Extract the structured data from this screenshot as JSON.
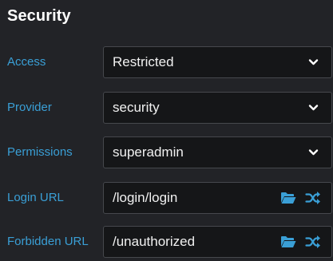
{
  "section": {
    "title": "Security"
  },
  "fields": {
    "access": {
      "label": "Access",
      "value": "Restricted"
    },
    "provider": {
      "label": "Provider",
      "value": "security"
    },
    "permissions": {
      "label": "Permissions",
      "value": "superadmin"
    },
    "login_url": {
      "label": "Login URL",
      "value": "/login/login"
    },
    "forbidden_url": {
      "label": "Forbidden URL",
      "value": "/unauthorized"
    }
  },
  "icons": {
    "dropdown": "chevron-down-icon",
    "browse": "folder-open-icon",
    "random": "shuffle-icon"
  },
  "colors": {
    "background": "#222327",
    "field_background": "#151618",
    "label": "#3a9fd6",
    "title": "#ffffff",
    "value": "#f1f1f1",
    "icon_accent": "#3a9fd6"
  }
}
